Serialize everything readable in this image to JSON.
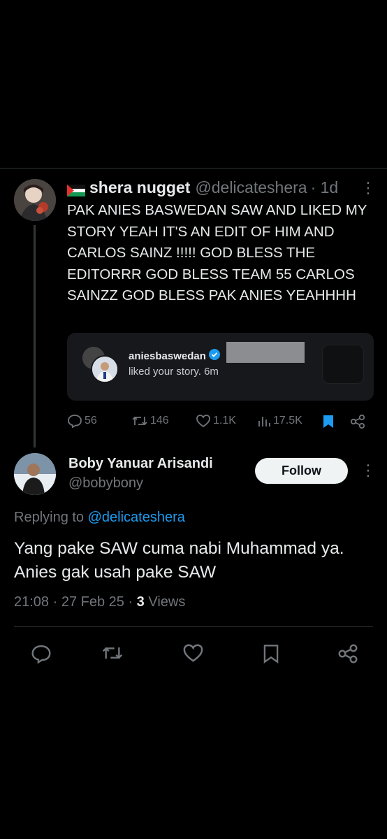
{
  "parent_tweet": {
    "display_name": "shera nugget",
    "handle": "@delicateshera",
    "time": "· 1d",
    "text": "PAK ANIES BASWEDAN SAW AND LIKED MY STORY YEAH IT'S AN EDIT OF HIM AND CARLOS SAINZ !!!!! GOD BLESS THE EDITORRR GOD BLESS TEAM 55 CARLOS SAINZZ GOD BLESS PAK ANIES YEAHHHH",
    "notification": {
      "username": "aniesbaswedan",
      "text": "liked your story. 6m"
    },
    "stats": {
      "replies": "56",
      "reposts": "146",
      "likes": "1.1K",
      "views": "17.5K"
    }
  },
  "reply": {
    "display_name": "Boby Yanuar Arisandi",
    "handle": "@bobybony",
    "follow_label": "Follow",
    "replying_prefix": "Replying to",
    "replying_handle": "@delicateshera",
    "text": "Yang pake SAW cuma nabi Muhammad ya. Anies gak usah pake SAW",
    "timestamp": "21:08 · 27 Feb 25 ·",
    "views_count": "3",
    "views_label": "Views"
  },
  "colors": {
    "background": "#000000",
    "text": "#e7e9ea",
    "muted": "#71767b",
    "link": "#1d9bf0",
    "bookmark_active": "#1d9bf0"
  }
}
